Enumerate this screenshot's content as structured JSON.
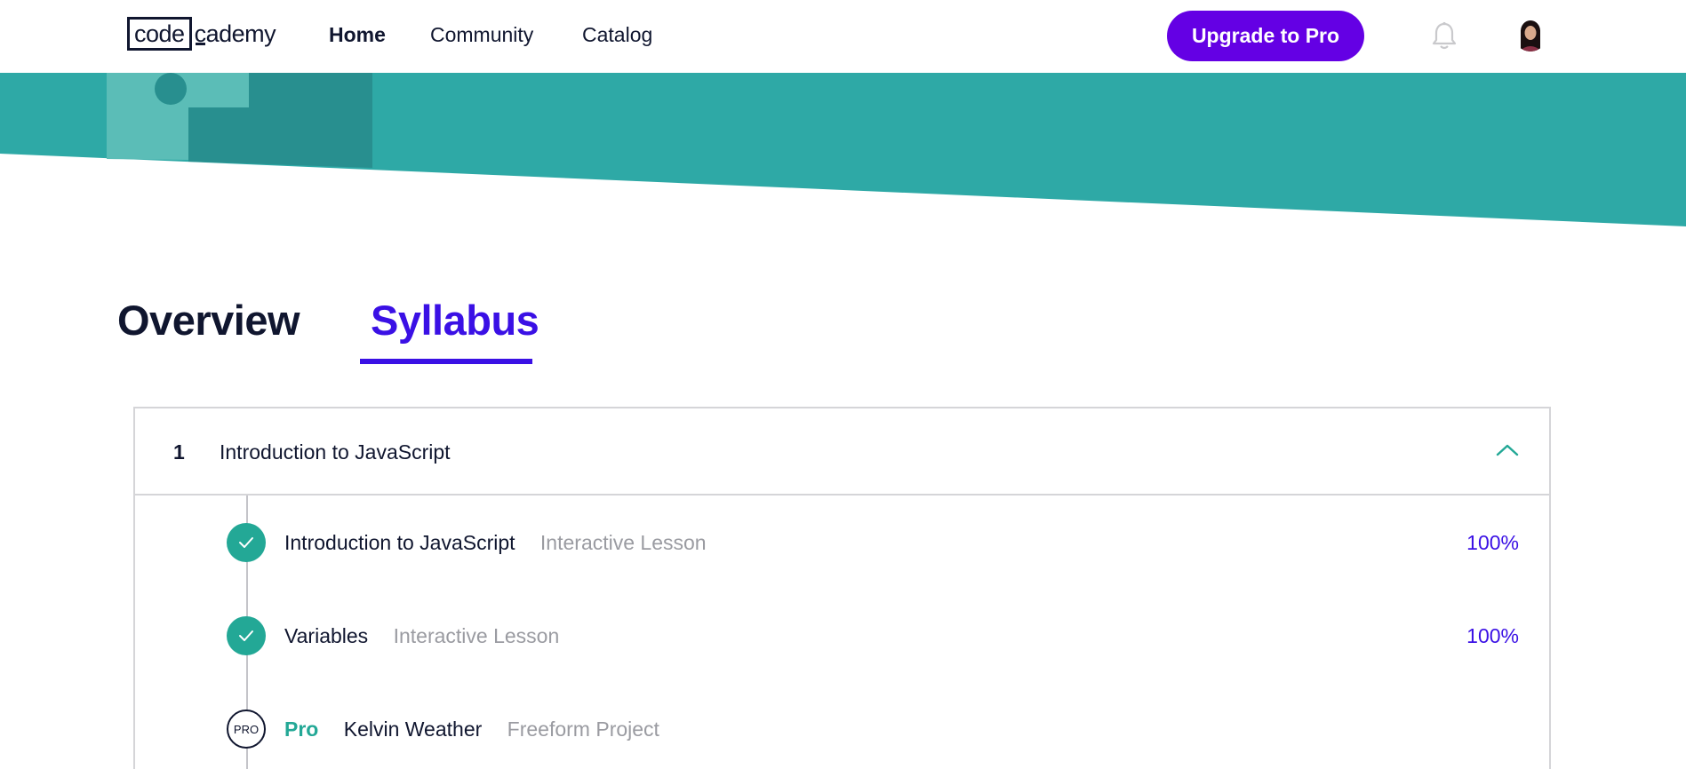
{
  "nav": {
    "logo_code": "code",
    "logo_rest": "cademy",
    "links": [
      "Home",
      "Community",
      "Catalog"
    ],
    "upgrade_label": "Upgrade to Pro"
  },
  "tabs": {
    "overview": "Overview",
    "syllabus": "Syllabus",
    "active": "Syllabus"
  },
  "module": {
    "number": "1",
    "title": "Introduction to JavaScript",
    "expanded": true,
    "items": [
      {
        "badge": "",
        "title": "Introduction to JavaScript",
        "type": "Interactive Lesson",
        "progress": "100%",
        "status": "complete"
      },
      {
        "badge": "",
        "title": "Variables",
        "type": "Interactive Lesson",
        "progress": "100%",
        "status": "complete"
      },
      {
        "badge": "Pro",
        "title": "Kelvin Weather",
        "type": "Freeform Project",
        "progress": "",
        "status": "pro",
        "icon_text": "PRO"
      }
    ]
  },
  "colors": {
    "brand_purple": "#6400e4",
    "accent_blue": "#3a10e5",
    "teal": "#2ea9a6",
    "teal_dark": "#288f8f",
    "check_green": "#23a896",
    "navy": "#10162f"
  }
}
